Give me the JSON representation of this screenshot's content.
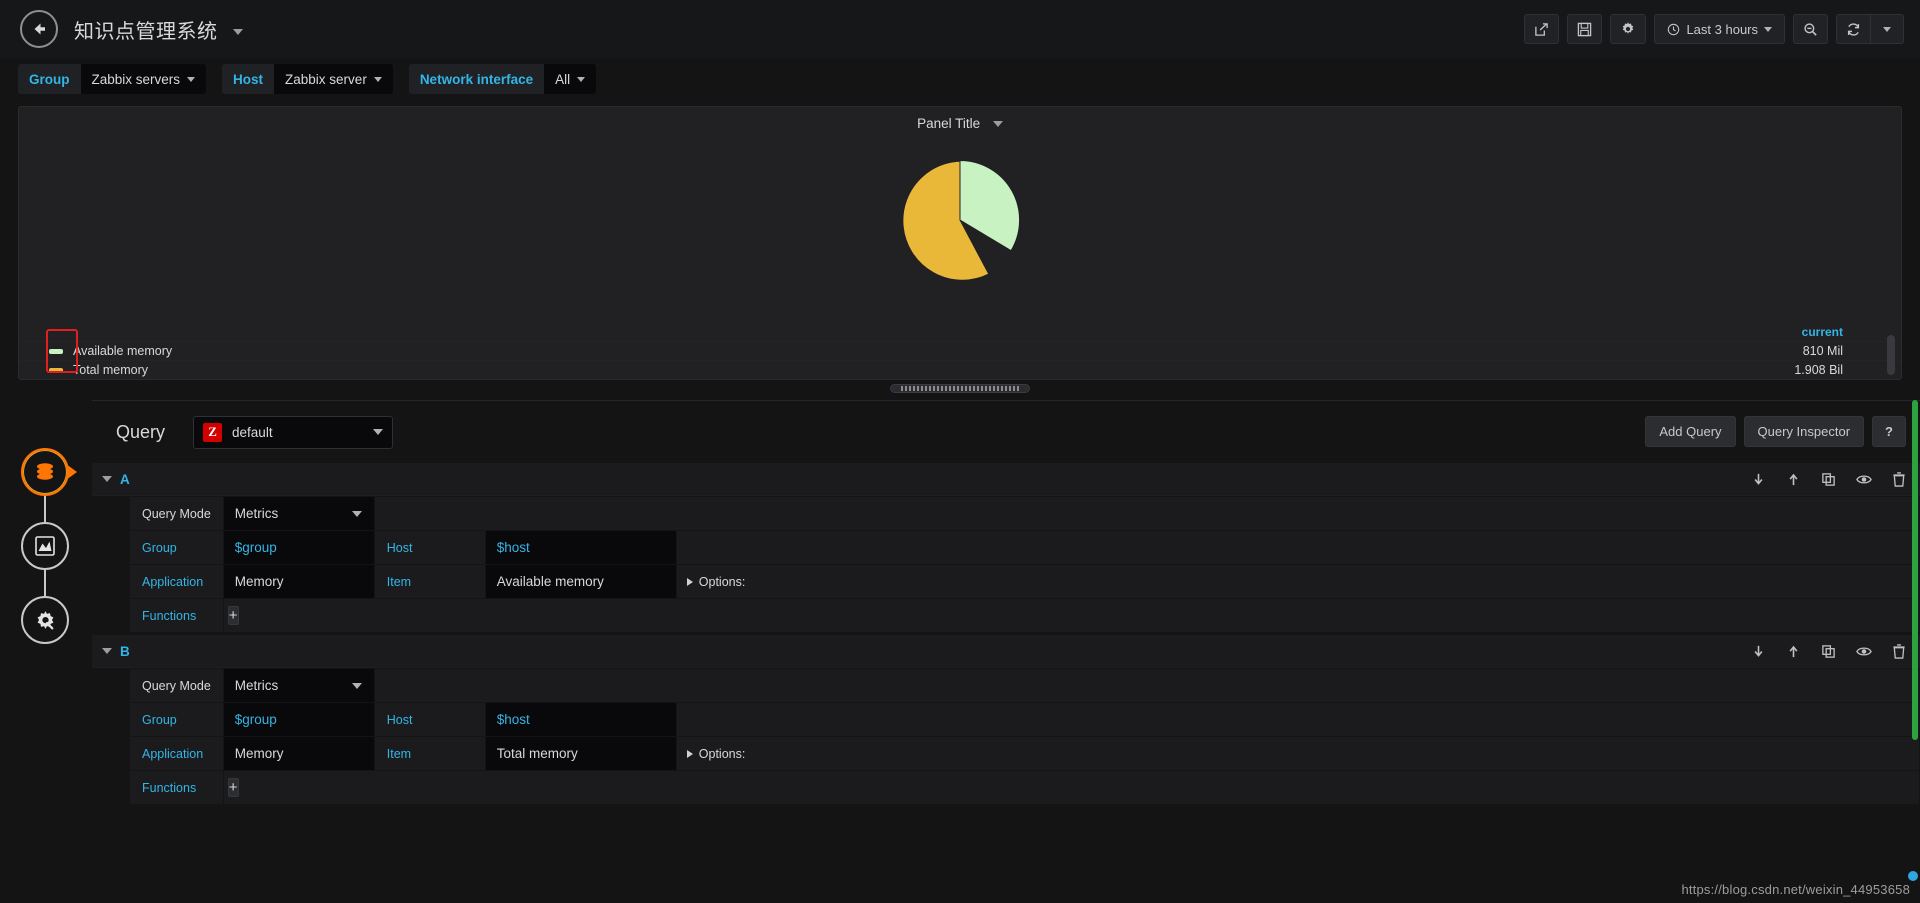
{
  "topnav": {
    "back_icon": "arrow-left-icon",
    "dashboard_title": "知识点管理系统",
    "buttons": [
      {
        "name": "share-dashboard-button",
        "icon": "share-icon"
      },
      {
        "name": "save-dashboard-button",
        "icon": "save-icon"
      },
      {
        "name": "dashboard-settings-button",
        "icon": "gear-icon"
      }
    ],
    "time_picker": {
      "icon": "clock-icon",
      "label": "Last 3 hours"
    },
    "zoom_out": {
      "name": "zoom-out-button",
      "icon": "magnifier-minus-icon"
    },
    "refresh": {
      "name": "refresh-button",
      "icon": "refresh-icon"
    }
  },
  "variables": [
    {
      "label": "Group",
      "value": "Zabbix servers"
    },
    {
      "label": "Host",
      "value": "Zabbix server"
    },
    {
      "label": "Network interface",
      "value": "All"
    }
  ],
  "panel": {
    "title": "Panel Title",
    "legend_header": "current",
    "legend": [
      {
        "name": "Available memory",
        "value": "810 Mil",
        "color": "#c8f2c2"
      },
      {
        "name": "Total memory",
        "value": "1.908 Bil",
        "color": "#eab839"
      }
    ]
  },
  "chart_data": {
    "type": "pie",
    "title": "Panel Title",
    "labels": [
      "Available memory",
      "Total memory"
    ],
    "values": [
      810,
      1908
    ],
    "value_labels": [
      "810 Mil",
      "1.908 Bil"
    ],
    "colors": [
      "#c8f2c2",
      "#eab839"
    ],
    "percentages": [
      29.8,
      70.2
    ],
    "legend_position": "bottom",
    "legend_columns": [
      "current"
    ],
    "units": "bytes"
  },
  "editor": {
    "query_label": "Query",
    "datasource": {
      "logo_letter": "Z",
      "name": "default"
    },
    "actions": {
      "add_query": "Add Query",
      "query_inspector": "Query Inspector",
      "help": "?"
    },
    "row_action_icons": [
      "move-down-icon",
      "move-up-icon",
      "duplicate-icon",
      "hide-eye-icon",
      "delete-trash-icon"
    ],
    "labels": {
      "query_mode": "Query Mode",
      "group": "Group",
      "host": "Host",
      "application": "Application",
      "item": "Item",
      "options": "Options:",
      "functions": "Functions",
      "add_function": "+"
    },
    "queries": [
      {
        "ref_id": "A",
        "query_mode": "Metrics",
        "group": "$group",
        "host": "$host",
        "application": "Memory",
        "item": "Available memory"
      },
      {
        "ref_id": "B",
        "query_mode": "Metrics",
        "group": "$group",
        "host": "$host",
        "application": "Memory",
        "item": "Total memory"
      }
    ]
  },
  "edit_nav": [
    {
      "name": "queries-tab",
      "icon": "database-icon",
      "active": true
    },
    {
      "name": "visualization-tab",
      "icon": "chart-area-icon",
      "active": false
    },
    {
      "name": "general-tab",
      "icon": "gear-wrench-icon",
      "active": false
    }
  ],
  "watermark": "https://blog.csdn.net/weixin_44953658"
}
